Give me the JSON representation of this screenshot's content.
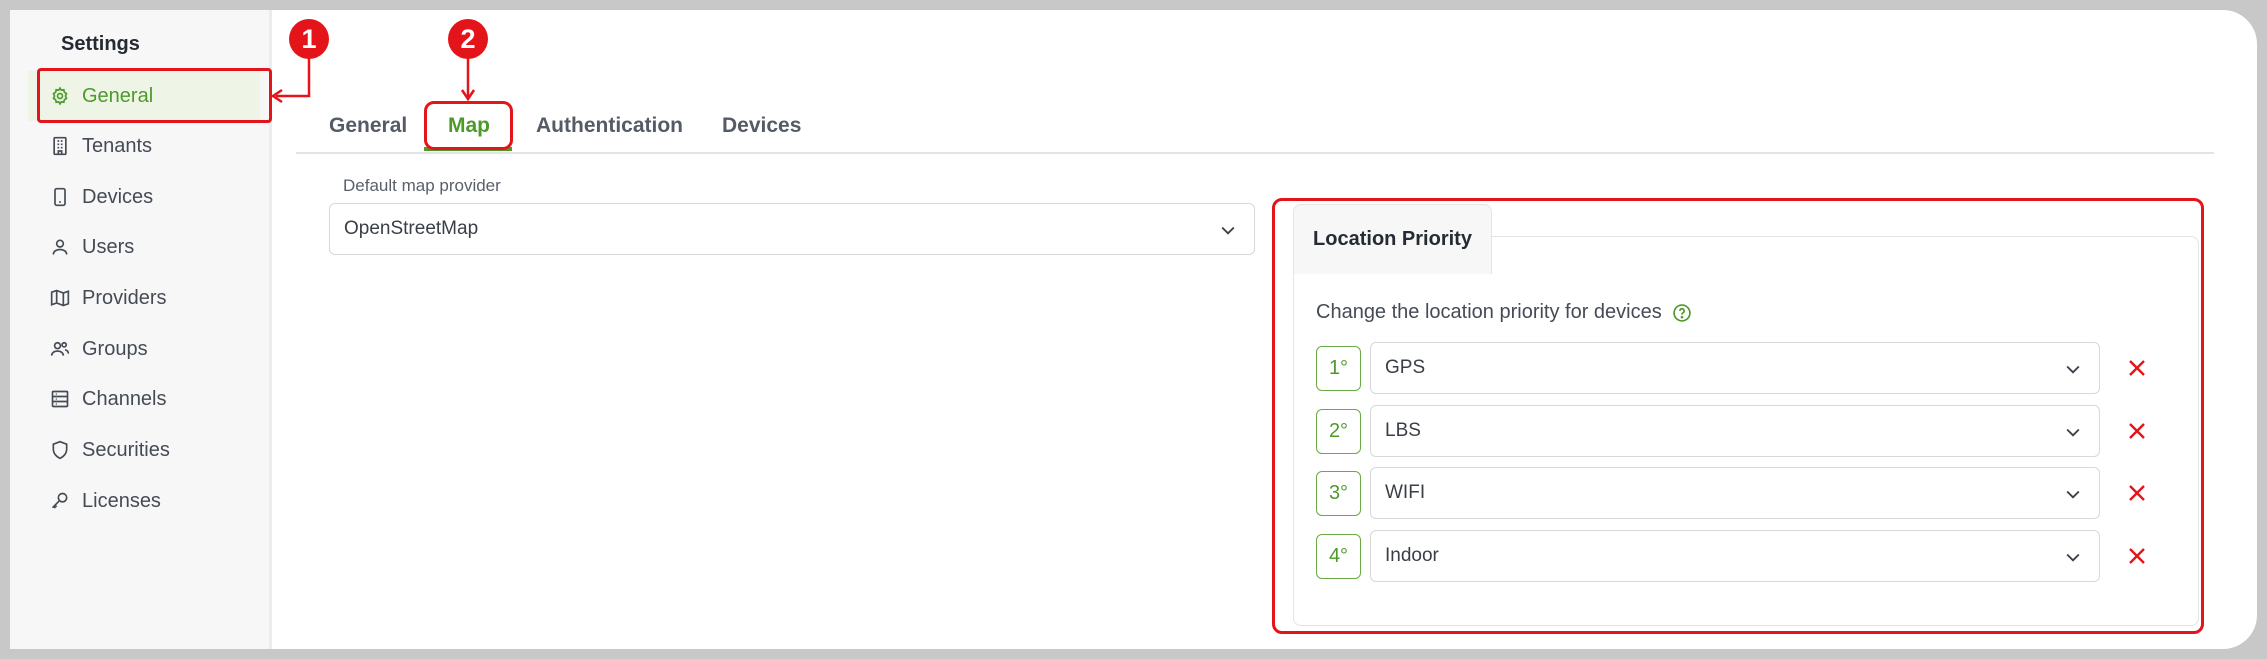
{
  "sidebar": {
    "title": "Settings",
    "items": [
      {
        "label": "General",
        "icon": "gear-icon",
        "active": true
      },
      {
        "label": "Tenants",
        "icon": "building-icon"
      },
      {
        "label": "Devices",
        "icon": "mobile-icon"
      },
      {
        "label": "Users",
        "icon": "user-icon"
      },
      {
        "label": "Providers",
        "icon": "map-icon"
      },
      {
        "label": "Groups",
        "icon": "group-icon"
      },
      {
        "label": "Channels",
        "icon": "server-icon"
      },
      {
        "label": "Securities",
        "icon": "shield-icon"
      },
      {
        "label": "Licenses",
        "icon": "key-icon"
      }
    ]
  },
  "tabs": [
    {
      "label": "General"
    },
    {
      "label": "Map",
      "active": true
    },
    {
      "label": "Authentication"
    },
    {
      "label": "Devices"
    }
  ],
  "map_provider": {
    "label": "Default map provider",
    "value": "OpenStreetMap"
  },
  "location_priority": {
    "title": "Location Priority",
    "description": "Change the location priority for devices",
    "rows": [
      {
        "rank": "1°",
        "value": "GPS"
      },
      {
        "rank": "2°",
        "value": "LBS"
      },
      {
        "rank": "3°",
        "value": "WIFI"
      },
      {
        "rank": "4°",
        "value": "Indoor"
      }
    ]
  },
  "annotations": [
    {
      "number": "1"
    },
    {
      "number": "2"
    }
  ],
  "colors": {
    "accent": "#4d9a2a",
    "annotation": "#e4141b",
    "remove": "#e4141b"
  }
}
